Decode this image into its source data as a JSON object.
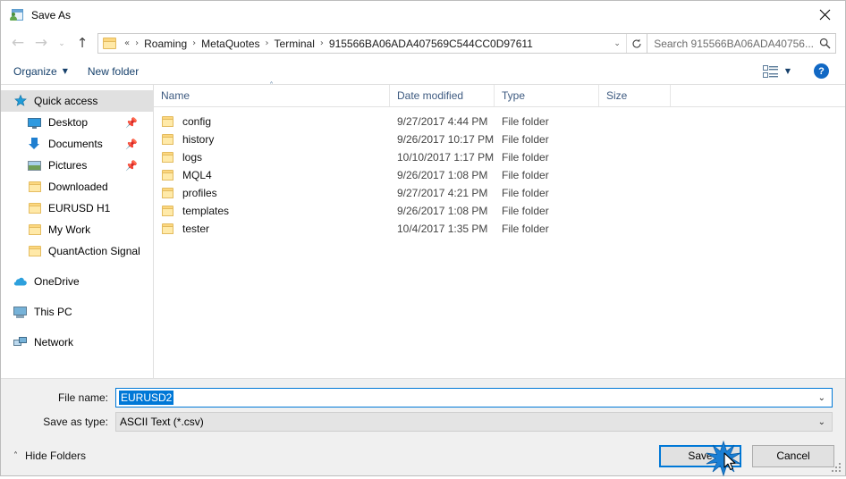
{
  "window": {
    "title": "Save As",
    "app_icon": "save-as-icon",
    "close_label": "✕"
  },
  "navigation": {
    "back_icon": "←",
    "forward_icon": "→",
    "recent_icon": "⌄",
    "up_icon": "↑",
    "breadcrumb_prefix": "«",
    "crumbs": [
      "Roaming",
      "MetaQuotes",
      "Terminal",
      "915566BA06ADA407569C544CC0D97611"
    ],
    "separator": "›",
    "dropdown_icon": "⌄",
    "refresh_icon": "↻"
  },
  "search": {
    "placeholder": "Search 915566BA06ADA40756...",
    "icon": "search-icon"
  },
  "toolbar": {
    "organize_label": "Organize",
    "organize_caret": "▼",
    "new_folder_label": "New folder",
    "view_caret": "▼",
    "help_label": "?"
  },
  "sidebar": {
    "groups": [
      {
        "header": {
          "label": "Quick access",
          "icon": "star-icon",
          "selected": true
        },
        "items": [
          {
            "label": "Desktop",
            "icon": "desktop-icon",
            "pinned": true
          },
          {
            "label": "Documents",
            "icon": "documents-icon",
            "pinned": true
          },
          {
            "label": "Pictures",
            "icon": "pictures-icon",
            "pinned": true
          },
          {
            "label": "Downloaded",
            "icon": "folder-icon",
            "pinned": false
          },
          {
            "label": "EURUSD H1",
            "icon": "folder-icon",
            "pinned": false
          },
          {
            "label": "My Work",
            "icon": "folder-icon",
            "pinned": false
          },
          {
            "label": "QuantAction Signal",
            "icon": "folder-icon",
            "pinned": false
          }
        ]
      },
      {
        "header": {
          "label": "OneDrive",
          "icon": "onedrive-icon",
          "selected": false
        },
        "items": []
      },
      {
        "header": {
          "label": "This PC",
          "icon": "this-pc-icon",
          "selected": false
        },
        "items": []
      },
      {
        "header": {
          "label": "Network",
          "icon": "network-icon",
          "selected": false
        },
        "items": []
      }
    ]
  },
  "filelist": {
    "columns": [
      "Name",
      "Date modified",
      "Type",
      "Size"
    ],
    "sort_column": "Name",
    "sort_caret": "˄",
    "rows": [
      {
        "name": "config",
        "date": "9/27/2017 4:44 PM",
        "type": "File folder",
        "size": ""
      },
      {
        "name": "history",
        "date": "9/26/2017 10:17 PM",
        "type": "File folder",
        "size": ""
      },
      {
        "name": "logs",
        "date": "10/10/2017 1:17 PM",
        "type": "File folder",
        "size": ""
      },
      {
        "name": "MQL4",
        "date": "9/26/2017 1:08 PM",
        "type": "File folder",
        "size": ""
      },
      {
        "name": "profiles",
        "date": "9/27/2017 4:21 PM",
        "type": "File folder",
        "size": ""
      },
      {
        "name": "templates",
        "date": "9/26/2017 1:08 PM",
        "type": "File folder",
        "size": ""
      },
      {
        "name": "tester",
        "date": "10/4/2017 1:35 PM",
        "type": "File folder",
        "size": ""
      }
    ]
  },
  "form": {
    "filename_label": "File name:",
    "filename_value": "EURUSD2",
    "filetype_label": "Save as type:",
    "filetype_value": "ASCII Text (*.csv)",
    "chevron": "⌄"
  },
  "footer": {
    "hide_folders_label": "Hide Folders",
    "hide_folders_caret": "˄",
    "save_label": "Save",
    "cancel_label": "Cancel"
  },
  "colors": {
    "accent": "#0078d7",
    "folder": "#fcd77f",
    "link_text": "#16406b",
    "selection": "#0078d7",
    "sidebar_selected": "#e0e0e0"
  }
}
